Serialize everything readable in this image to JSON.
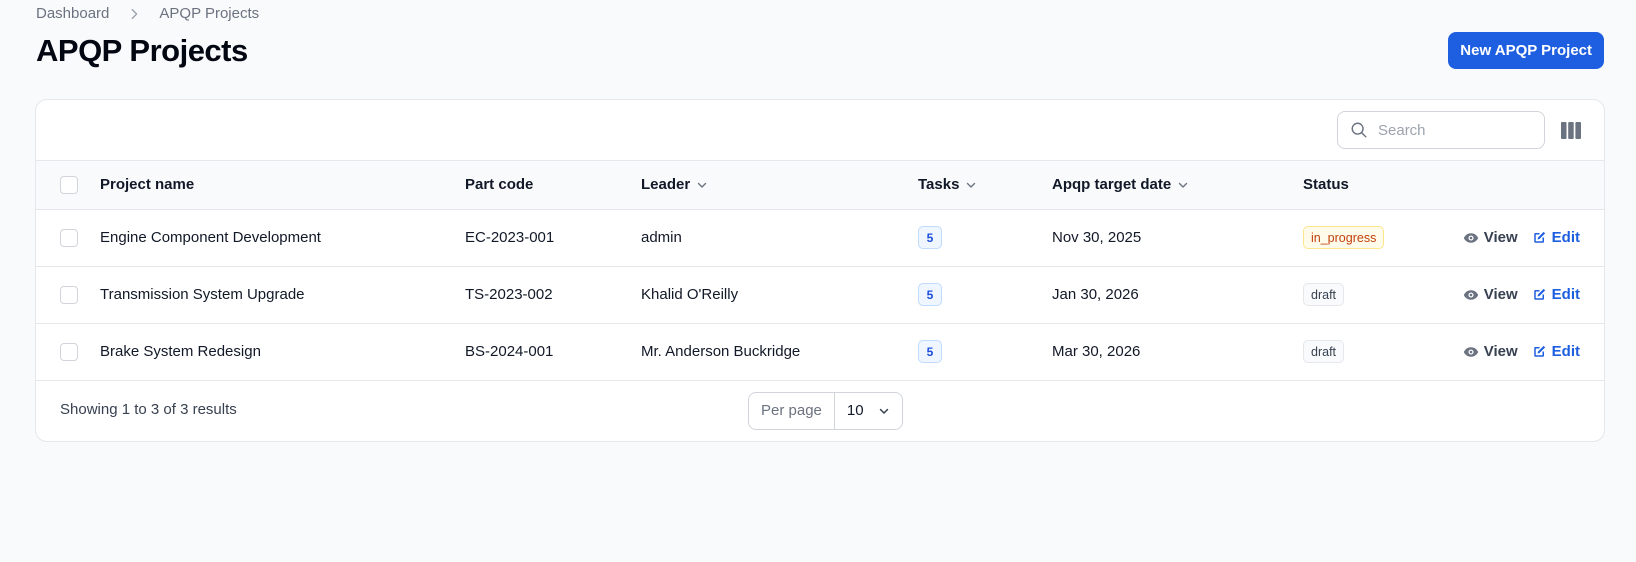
{
  "breadcrumb": {
    "items": [
      "Dashboard",
      "APQP Projects"
    ]
  },
  "page_title": "APQP Projects",
  "new_button_label": "New APQP Project",
  "search": {
    "placeholder": "Search",
    "value": ""
  },
  "table": {
    "headers": {
      "project_name": "Project name",
      "part_code": "Part code",
      "leader": "Leader",
      "tasks": "Tasks",
      "target_date": "Apqp target date",
      "status": "Status"
    },
    "rows": [
      {
        "project_name": "Engine Component Development",
        "part_code": "EC-2023-001",
        "leader": "admin",
        "tasks": "5",
        "target_date": "Nov 30, 2025",
        "status": "in_progress",
        "view": "View",
        "edit": "Edit"
      },
      {
        "project_name": "Transmission System Upgrade",
        "part_code": "TS-2023-002",
        "leader": "Khalid O'Reilly",
        "tasks": "5",
        "target_date": "Jan 30, 2026",
        "status": "draft",
        "view": "View",
        "edit": "Edit"
      },
      {
        "project_name": "Brake System Redesign",
        "part_code": "BS-2024-001",
        "leader": "Mr. Anderson Buckridge",
        "tasks": "5",
        "target_date": "Mar 30, 2026",
        "status": "draft",
        "view": "View",
        "edit": "Edit"
      }
    ]
  },
  "footer": {
    "results_text": "Showing 1 to 3 of 3 results",
    "per_page_label": "Per page",
    "per_page_value": "10"
  },
  "colors": {
    "primary": "#1d5fe0",
    "in_progress": "#c2410c",
    "draft": "#374151"
  },
  "icons": [
    "chevron-right-icon",
    "search-icon",
    "columns-icon",
    "chevron-down-icon",
    "eye-icon",
    "edit-icon"
  ]
}
